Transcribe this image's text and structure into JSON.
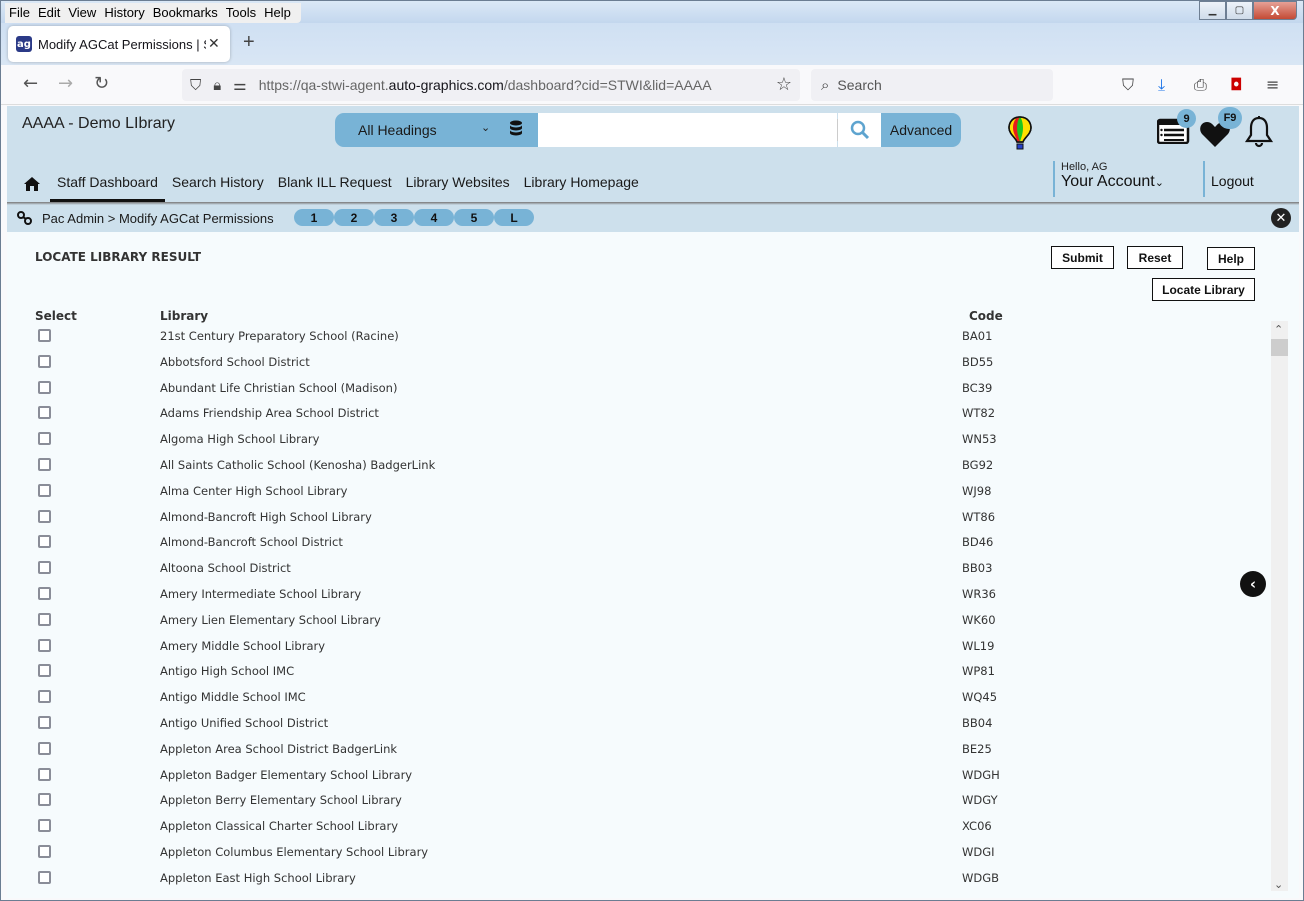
{
  "browser": {
    "menu": [
      "File",
      "Edit",
      "View",
      "History",
      "Bookmarks",
      "Tools",
      "Help"
    ],
    "tab_title": "Modify AGCat Permissions | STWI",
    "url_prefix": "https://qa-stwi-agent.",
    "url_domain": "auto-graphics.com",
    "url_suffix": "/dashboard?cid=STWI&lid=AAAA",
    "search_placeholder": "Search"
  },
  "header": {
    "library_name": "AAAA - Demo LIbrary",
    "search_scope": "All Headings",
    "search_value": "",
    "advanced_label": "Advanced",
    "list_badge": "9",
    "favorites_badge": "F9",
    "greeting": "Hello, AG",
    "account_label": "Your Account",
    "logout_label": "Logout"
  },
  "nav": {
    "items": [
      "Staff Dashboard",
      "Search History",
      "Blank ILL Request",
      "Library Websites",
      "Library Homepage"
    ],
    "active": "Staff Dashboard"
  },
  "breadcrumb": {
    "text": "Pac Admin > Modify AGCat Permissions",
    "pills": [
      "1",
      "2",
      "3",
      "4",
      "5",
      "L"
    ]
  },
  "content": {
    "title": "LOCATE LIBRARY RESULT",
    "buttons": {
      "submit": "Submit",
      "reset": "Reset",
      "help": "Help",
      "locate": "Locate Library"
    },
    "columns": {
      "select": "Select",
      "library": "Library",
      "code": "Code"
    },
    "rows": [
      {
        "library": "21st Century Preparatory School (Racine)",
        "code": "BA01",
        "selected": false
      },
      {
        "library": "Abbotsford School District",
        "code": "BD55",
        "selected": false
      },
      {
        "library": "Abundant Life Christian School (Madison)",
        "code": "BC39",
        "selected": false
      },
      {
        "library": "Adams Friendship Area School District",
        "code": "WT82",
        "selected": false
      },
      {
        "library": "Algoma High School Library",
        "code": "WN53",
        "selected": false
      },
      {
        "library": "All Saints Catholic School (Kenosha) BadgerLink",
        "code": "BG92",
        "selected": false
      },
      {
        "library": "Alma Center High School Library",
        "code": "WJ98",
        "selected": false
      },
      {
        "library": "Almond-Bancroft High School Library",
        "code": "WT86",
        "selected": false
      },
      {
        "library": "Almond-Bancroft School District",
        "code": "BD46",
        "selected": false
      },
      {
        "library": "Altoona School District",
        "code": "BB03",
        "selected": false
      },
      {
        "library": "Amery Intermediate School Library",
        "code": "WR36",
        "selected": false
      },
      {
        "library": "Amery Lien Elementary School Library",
        "code": "WK60",
        "selected": false
      },
      {
        "library": "Amery Middle School Library",
        "code": "WL19",
        "selected": false
      },
      {
        "library": "Antigo High School IMC",
        "code": "WP81",
        "selected": false
      },
      {
        "library": "Antigo Middle School IMC",
        "code": "WQ45",
        "selected": false
      },
      {
        "library": "Antigo Unified School District",
        "code": "BB04",
        "selected": false
      },
      {
        "library": "Appleton Area School District BadgerLink",
        "code": "BE25",
        "selected": false
      },
      {
        "library": "Appleton Badger Elementary School Library",
        "code": "WDGH",
        "selected": false
      },
      {
        "library": "Appleton Berry Elementary School Library",
        "code": "WDGY",
        "selected": false
      },
      {
        "library": "Appleton Classical Charter School Library",
        "code": "XC06",
        "selected": false
      },
      {
        "library": "Appleton Columbus Elementary School Library",
        "code": "WDGI",
        "selected": false
      },
      {
        "library": "Appleton East High School Library",
        "code": "WDGB",
        "selected": false
      }
    ]
  },
  "colors": {
    "header_bg": "#cde0ec",
    "accent": "#78b3d6",
    "page_bg": "#f6fbfd"
  }
}
